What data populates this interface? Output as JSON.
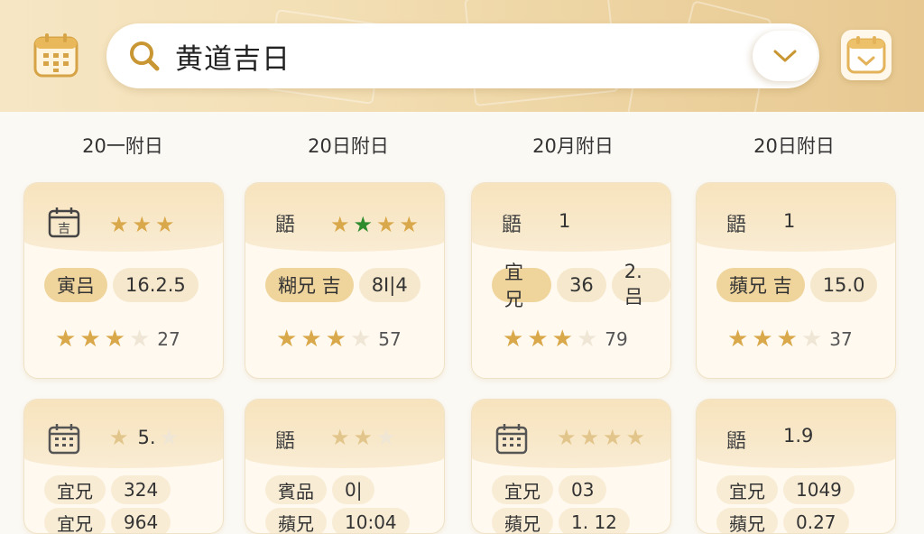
{
  "search": {
    "query": "黄道吉日"
  },
  "icons": {
    "left": "calendar-grid-icon",
    "right": "calendar-check-icon",
    "search": "magnifier-icon",
    "dropdown": "chevron-down-icon"
  },
  "colors": {
    "accent": "#d9a84a",
    "header": "#f3dfb5",
    "card": "#fff9ef",
    "pill": "#efd49c",
    "green_star": "#2e8b2e"
  },
  "columns": [
    "20一附日",
    "20日附日",
    "20月附日",
    "20日附日"
  ],
  "row1": [
    {
      "icon": "吉",
      "top_stars_on": 3,
      "top_stars_off": 0,
      "pill_label": "寅吕",
      "pill_value": "16.2.5",
      "rating_on": 3,
      "rating_off": 1,
      "count": "27"
    },
    {
      "icon": "鼯",
      "top_stars_on": 4,
      "top_stars_off": 0,
      "green_index": 1,
      "pill_label": "糊兄 吉",
      "pill_value": "8I|4",
      "rating_on": 3,
      "rating_off": 1,
      "count": "57"
    },
    {
      "icon": "鼯",
      "top_text": "1",
      "pill_label": "宜兄",
      "pill_value": "36",
      "pill_value2": "2.吕",
      "rating_on": 3,
      "rating_off": 1,
      "count": "79"
    },
    {
      "icon": "鼯",
      "top_text": "1",
      "pill_label": "蘋兄 吉",
      "pill_value": "15.0",
      "rating_on": 3,
      "rating_off": 1,
      "count": "37"
    }
  ],
  "row2": [
    {
      "icon": "cal",
      "top_stars_on": 1,
      "top_text": "5.",
      "pill_label": "宜兄",
      "pill_value": "324",
      "pill2_label": "宜兄",
      "pill2_value": "964"
    },
    {
      "icon": "鼯",
      "top_stars_on": 2,
      "top_stars_off": 1,
      "pill_label": "賓品",
      "pill_value": "0|",
      "pill2_label": "蘋兄",
      "pill2_value": "10:04"
    },
    {
      "icon": "cal",
      "top_stars_on": 4,
      "top_stars_off": 0,
      "pill_label": "宜兄",
      "pill_value": "03",
      "pill2_label": "蘋兄",
      "pill2_value": "1. 12"
    },
    {
      "icon": "鼯",
      "top_text": "1.9",
      "pill_label": "宜兄",
      "pill_value": "1049",
      "pill2_label": "蘋兄",
      "pill2_value": "0.27"
    }
  ]
}
